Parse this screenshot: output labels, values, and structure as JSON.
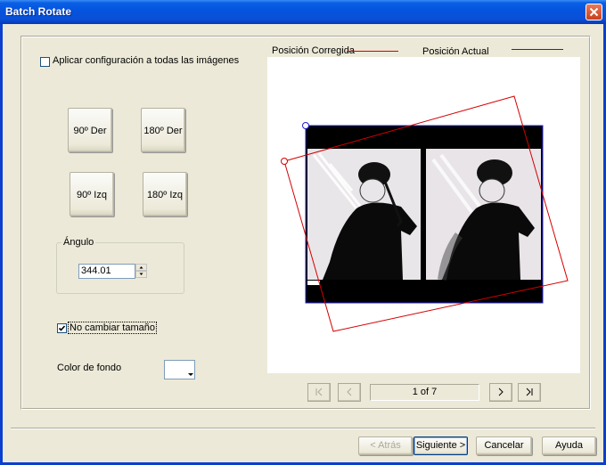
{
  "window": {
    "title": "Batch Rotate"
  },
  "options": {
    "apply_all_label": "Aplicar configuración a todas las imágenes",
    "apply_all_checked": false
  },
  "rotation_buttons": {
    "rot_90_right": "90º Der",
    "rot_180_right": "180º Der",
    "rot_90_left": "90º Izq",
    "rot_180_left": "180º Izq"
  },
  "angle": {
    "group_label": "Ángulo",
    "value": "344.01"
  },
  "no_resize": {
    "label": "No cambiar tamaño",
    "checked": true
  },
  "background": {
    "label": "Color de fondo",
    "color": "#ffffff"
  },
  "preview": {
    "legend_corrected": "Posición Corregida",
    "legend_corrected_color": "#d40000",
    "legend_current": "Posición Actual",
    "legend_current_color": "#2020c8",
    "rotation_angle": 344.01
  },
  "pagination": {
    "first_icon": "first-page-icon",
    "prev_icon": "previous-page-icon",
    "page_text": "1 of 7",
    "next_icon": "next-page-icon",
    "last_icon": "last-page-icon"
  },
  "footer": {
    "back_label": "< Atrás",
    "next_label": "Siguiente >",
    "cancel_label": "Cancelar",
    "help_label": "Ayuda"
  }
}
